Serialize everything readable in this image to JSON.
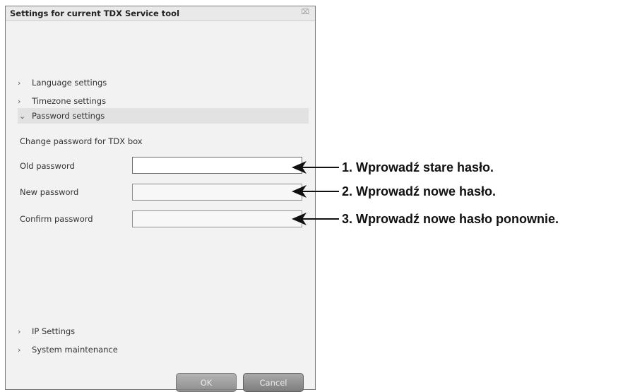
{
  "dialog": {
    "title": "Settings for current TDX Service tool",
    "close_icon": "close-icon"
  },
  "sections": {
    "language": "Language settings",
    "timezone": "Timezone settings",
    "password": "Password settings",
    "ip": "IP Settings",
    "maintenance": "System maintenance",
    "collapsed_icon": "chevron-right-icon",
    "expanded_icon": "chevron-down-icon"
  },
  "password_panel": {
    "heading": "Change password for TDX box",
    "old_label": "Old password",
    "new_label": "New password",
    "confirm_label": "Confirm password",
    "old_value": "",
    "new_value": "",
    "confirm_value": ""
  },
  "buttons": {
    "ok": "OK",
    "cancel": "Cancel"
  },
  "annotations": [
    "1. Wprowadź stare hasło.",
    "2. Wprowadź nowe hasło.",
    "3. Wprowadź nowe hasło ponownie."
  ],
  "colors": {
    "dialog_background": "#f2f2f2",
    "expanded_section": "#e2e2e2",
    "button": "#8c8c8c"
  }
}
